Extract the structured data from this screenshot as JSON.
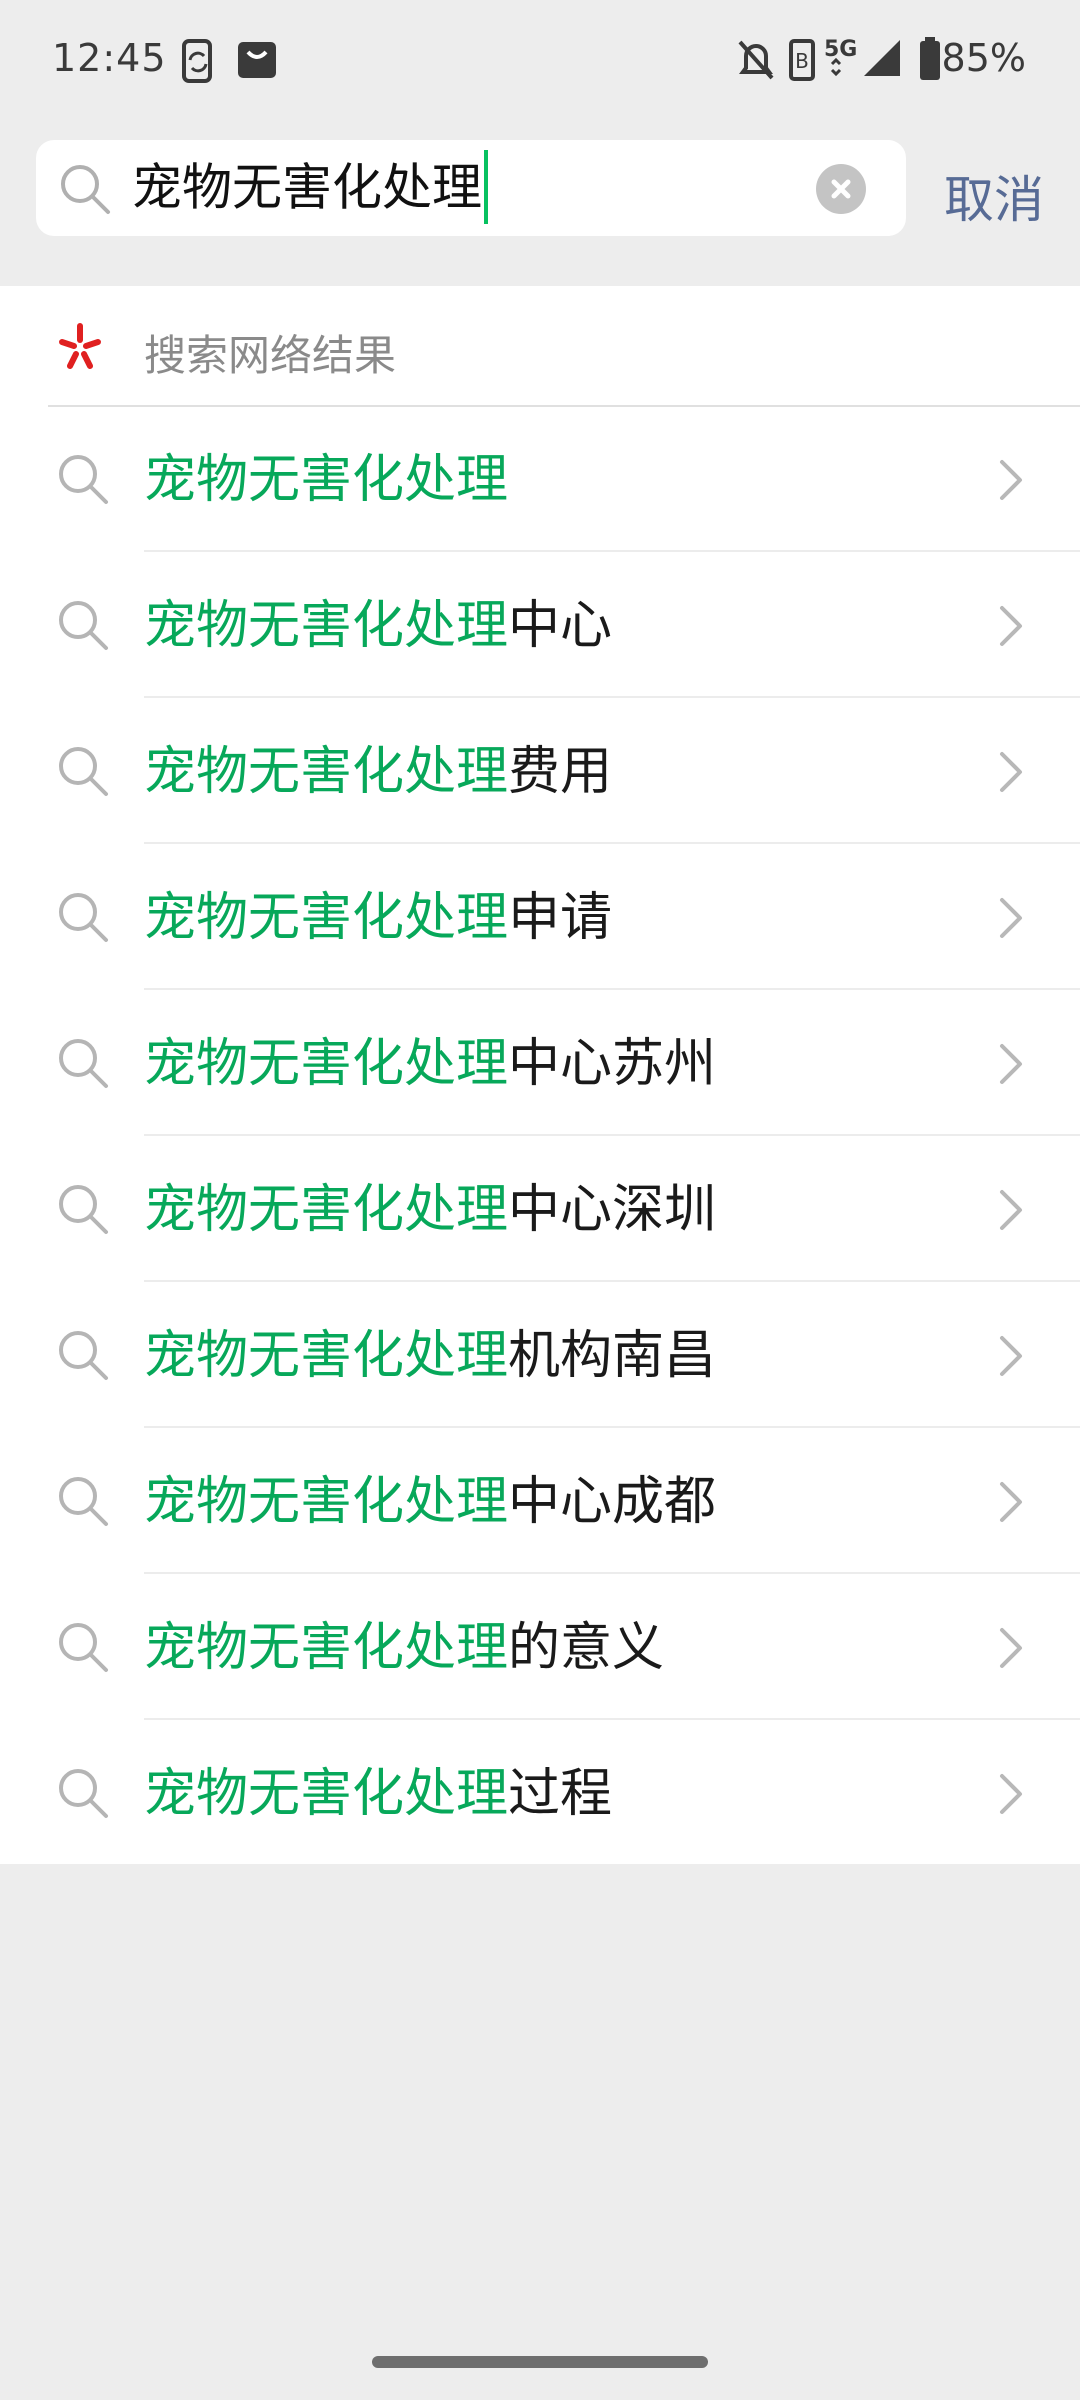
{
  "status_bar": {
    "time": "12:45",
    "network": "5G",
    "battery": "85%"
  },
  "search": {
    "query": "宠物无害化处理",
    "cancel_label": "取消"
  },
  "web_results": {
    "label": "搜索网络结果"
  },
  "suggestions": [
    {
      "match": "宠物无害化处理",
      "rest": ""
    },
    {
      "match": "宠物无害化处理",
      "rest": "中心"
    },
    {
      "match": "宠物无害化处理",
      "rest": "费用"
    },
    {
      "match": "宠物无害化处理",
      "rest": "申请"
    },
    {
      "match": "宠物无害化处理",
      "rest": "中心苏州"
    },
    {
      "match": "宠物无害化处理",
      "rest": "中心深圳"
    },
    {
      "match": "宠物无害化处理",
      "rest": "机构南昌"
    },
    {
      "match": "宠物无害化处理",
      "rest": "中心成都"
    },
    {
      "match": "宠物无害化处理",
      "rest": "的意义"
    },
    {
      "match": "宠物无害化处理",
      "rest": "过程"
    }
  ],
  "colors": {
    "match": "#07a85a",
    "accent_link": "#576b95",
    "caret": "#07c160",
    "logo": "#e02020"
  }
}
